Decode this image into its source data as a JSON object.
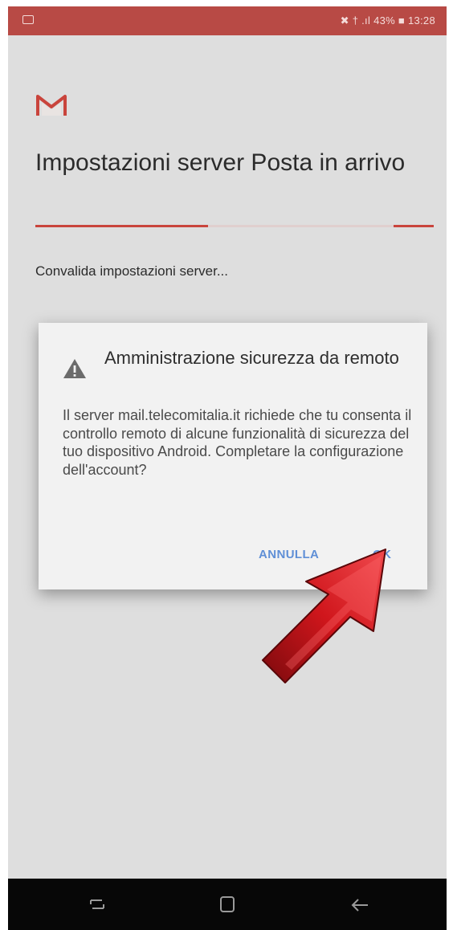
{
  "status_bar": {
    "image_icon": "image-notification-icon",
    "indicators": "✖ † .ıl 43% ■ 13:28",
    "battery": "43%",
    "time": "13:28"
  },
  "app_icon": "gmail-logo",
  "page": {
    "title": "Impostazioni server Posta in arrivo",
    "status_text": "Convalida impostazioni server..."
  },
  "dialog": {
    "icon": "warning-icon",
    "title": "Amministrazione sicurezza da remoto",
    "body": "Il server mail.telecomitalia.it richiede che tu consenta il controllo remoto di alcune funzionalità di sicurezza del tuo dispositivo Android. Completare la configurazione dell'account?",
    "cancel_label": "ANNULLA",
    "ok_label": "OK"
  },
  "annotation": {
    "arrow_icon": "red-arrow-pointer",
    "arrow_color": "#d0161c"
  },
  "nav_bar": {
    "recent": "recent-apps-icon",
    "home": "home-icon",
    "back": "back-icon"
  },
  "colors": {
    "status_bar": "#b84a45",
    "accent": "#c9443c",
    "button_text": "#5f8fd6"
  }
}
